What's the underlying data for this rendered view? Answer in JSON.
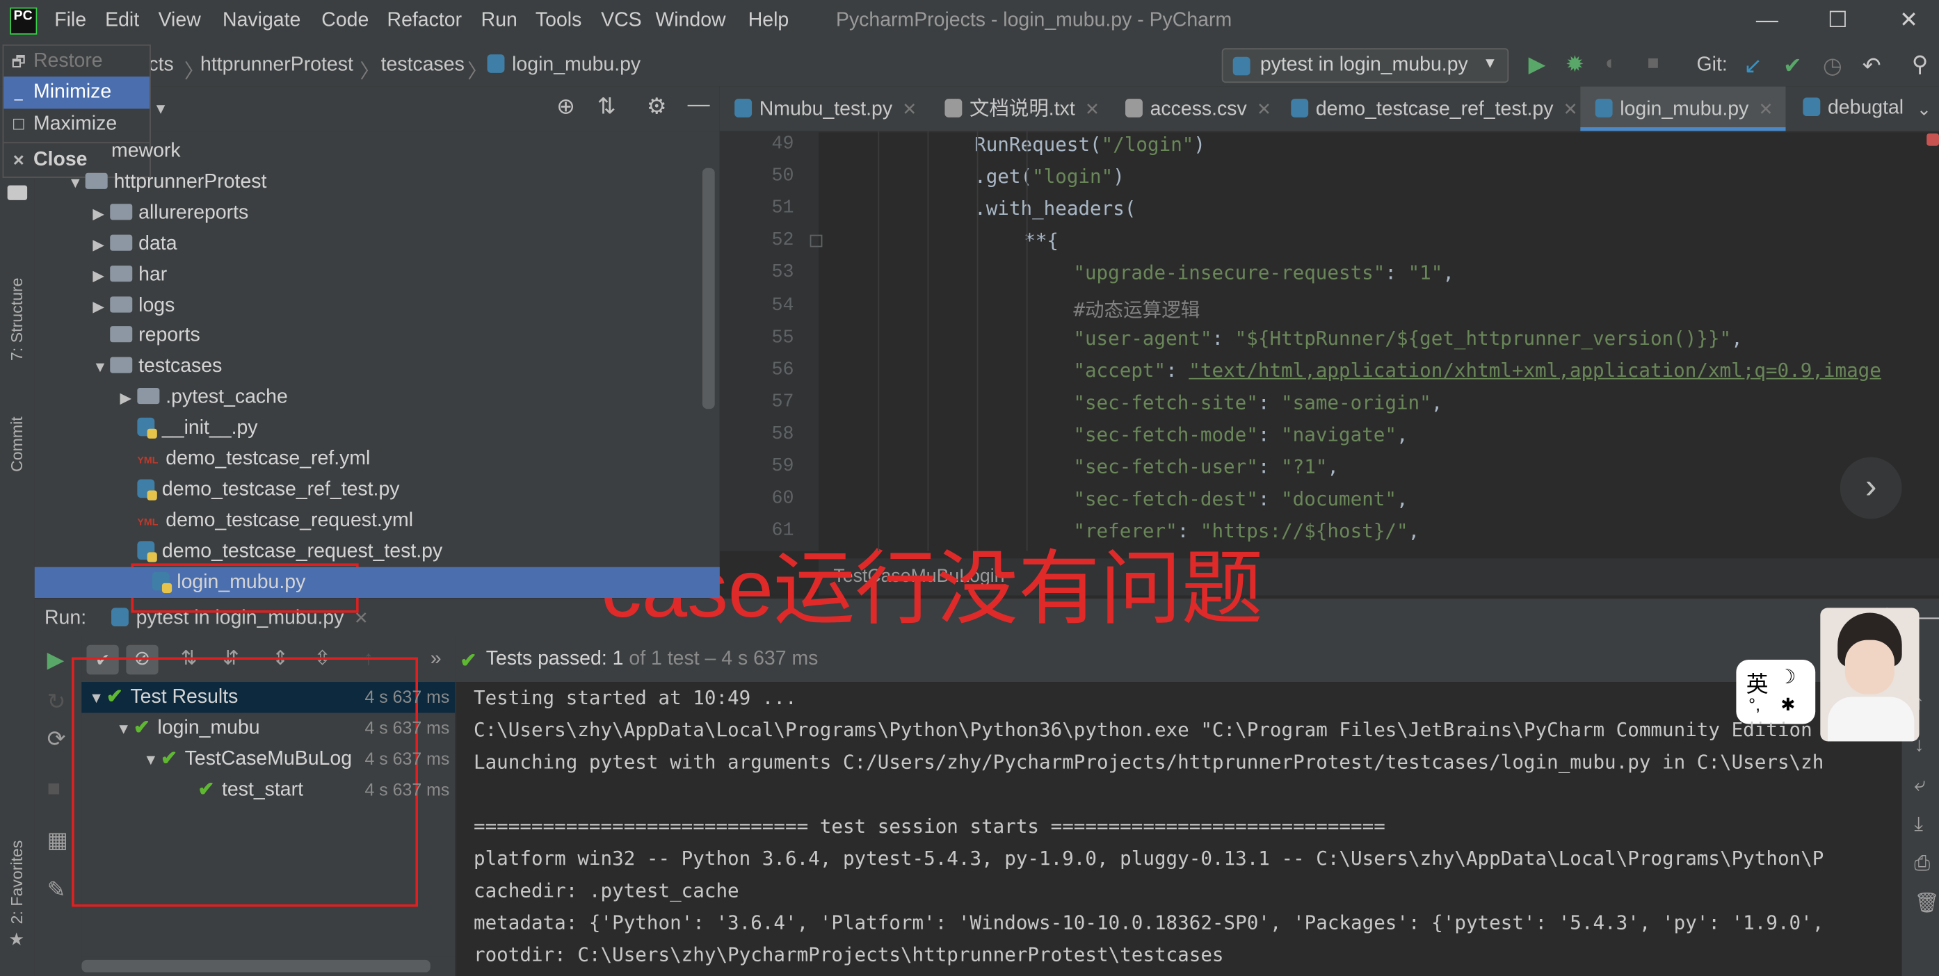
{
  "window": {
    "title": "PycharmProjects - login_mubu.py - PyCharm",
    "app_logo": "PC",
    "minimize_glyph": "—",
    "maximize_glyph": "☐",
    "close_glyph": "✕"
  },
  "menubar": {
    "items": [
      "File",
      "Edit",
      "View",
      "Navigate",
      "Code",
      "Refactor",
      "Run",
      "Tools",
      "VCS",
      "Window",
      "Help"
    ]
  },
  "system_menu": {
    "items": [
      {
        "key": "🗗",
        "label": "Restore",
        "enabled": false
      },
      {
        "key": "_",
        "label": "Minimize",
        "enabled": true,
        "selected": true
      },
      {
        "key": "☐",
        "label": "Maximize",
        "enabled": true
      },
      {
        "key": "✕",
        "label": "Close",
        "enabled": true,
        "bold": true
      }
    ]
  },
  "navbar": {
    "breadcrumbs": [
      "cts",
      "httprunnerProtest",
      "testcases",
      "login_mubu.py"
    ],
    "run_config": "pytest in login_mubu.py",
    "git_label": "Git:"
  },
  "left_stripe": {
    "structure": "7: Structure",
    "commit": "Commit",
    "favorites": "2: Favorites"
  },
  "project_tree": {
    "rows": [
      {
        "indent": 90,
        "label": "mework",
        "type": "text"
      },
      {
        "indent": 55,
        "label": "httprunnerProtest",
        "type": "folder",
        "expanded": true
      },
      {
        "indent": 75,
        "label": "allurereports",
        "type": "folder",
        "collapsed": true
      },
      {
        "indent": 75,
        "label": "data",
        "type": "folder",
        "collapsed": true
      },
      {
        "indent": 75,
        "label": "har",
        "type": "folder",
        "collapsed": true
      },
      {
        "indent": 75,
        "label": "logs",
        "type": "folder",
        "collapsed": true
      },
      {
        "indent": 75,
        "label": "reports",
        "type": "folder",
        "leaf": true
      },
      {
        "indent": 75,
        "label": "testcases",
        "type": "folder",
        "expanded": true
      },
      {
        "indent": 97,
        "label": ".pytest_cache",
        "type": "folder",
        "collapsed": true
      },
      {
        "indent": 97,
        "label": "__init__.py",
        "type": "py",
        "leaf": true
      },
      {
        "indent": 97,
        "label": "demo_testcase_ref.yml",
        "type": "yml",
        "leaf": true
      },
      {
        "indent": 97,
        "label": "demo_testcase_ref_test.py",
        "type": "py",
        "leaf": true
      },
      {
        "indent": 97,
        "label": "demo_testcase_request.yml",
        "type": "yml",
        "leaf": true
      },
      {
        "indent": 97,
        "label": "demo_testcase_request_test.py",
        "type": "py",
        "leaf": true
      },
      {
        "indent": 97,
        "label": "login_mubu.py",
        "type": "py",
        "leaf": true,
        "selected": true
      }
    ]
  },
  "editor_tabs": [
    {
      "label": "Nmubu_test.py",
      "active": false
    },
    {
      "label": "文档说明.txt",
      "active": false
    },
    {
      "label": "access.csv",
      "active": false
    },
    {
      "label": "demo_testcase_ref_test.py",
      "active": false
    },
    {
      "label": "login_mubu.py",
      "active": true
    },
    {
      "label": "debugtal",
      "active": false
    }
  ],
  "code": {
    "lines": [
      {
        "n": "49",
        "indent": 788,
        "parts": [
          [
            "RunRequest(",
            ""
          ],
          [
            "\"/login\"",
            "str"
          ],
          [
            ")",
            ""
          ]
        ]
      },
      {
        "n": "50",
        "indent": 788,
        "parts": [
          [
            ".get(",
            ""
          ],
          [
            "\"login\"",
            "str"
          ],
          [
            ")",
            ""
          ]
        ]
      },
      {
        "n": "51",
        "indent": 788,
        "parts": [
          [
            ".with_headers(",
            ""
          ]
        ]
      },
      {
        "n": "52",
        "indent": 828,
        "parts": [
          [
            "**{",
            ""
          ]
        ]
      },
      {
        "n": "53",
        "indent": 868,
        "parts": [
          [
            "\"upgrade-insecure-requests\"",
            "str"
          ],
          [
            ": ",
            ""
          ],
          [
            "\"1\"",
            "str"
          ],
          [
            ",",
            ""
          ]
        ]
      },
      {
        "n": "54",
        "indent": 868,
        "parts": [
          [
            "#动态运算逻辑",
            "cmt"
          ]
        ]
      },
      {
        "n": "55",
        "indent": 868,
        "parts": [
          [
            "\"user-agent\"",
            "str"
          ],
          [
            ": ",
            ""
          ],
          [
            "\"${HttpRunner/${get_httprunner_version()}}\"",
            "str"
          ],
          [
            ",",
            ""
          ]
        ]
      },
      {
        "n": "56",
        "indent": 868,
        "parts": [
          [
            "\"accept\"",
            "str"
          ],
          [
            ": ",
            ""
          ],
          [
            "\"text/html,application/xhtml+xml,application/xml;q=0.9,image",
            "str und"
          ]
        ]
      },
      {
        "n": "57",
        "indent": 868,
        "parts": [
          [
            "\"sec-fetch-site\"",
            "str"
          ],
          [
            ": ",
            ""
          ],
          [
            "\"same-origin\"",
            "str"
          ],
          [
            ",",
            ""
          ]
        ]
      },
      {
        "n": "58",
        "indent": 868,
        "parts": [
          [
            "\"sec-fetch-mode\"",
            "str"
          ],
          [
            ": ",
            ""
          ],
          [
            "\"navigate\"",
            "str"
          ],
          [
            ",",
            ""
          ]
        ]
      },
      {
        "n": "59",
        "indent": 868,
        "parts": [
          [
            "\"sec-fetch-user\"",
            "str"
          ],
          [
            ": ",
            ""
          ],
          [
            "\"?1\"",
            "str"
          ],
          [
            ",",
            ""
          ]
        ]
      },
      {
        "n": "60",
        "indent": 868,
        "parts": [
          [
            "\"sec-fetch-dest\"",
            "str"
          ],
          [
            ": ",
            ""
          ],
          [
            "\"document\"",
            "str"
          ],
          [
            ",",
            ""
          ]
        ]
      },
      {
        "n": "61",
        "indent": 868,
        "parts": [
          [
            "\"referer\"",
            "str"
          ],
          [
            ": ",
            ""
          ],
          [
            "\"https://${host}/\"",
            "str"
          ],
          [
            ",",
            ""
          ]
        ]
      }
    ],
    "structure_breadcrumb": "TestCaseMuBuLogin"
  },
  "run_panel": {
    "label": "Run:",
    "tab": "pytest in login_mubu.py",
    "status_prefix": "Tests passed:",
    "status_count": "1",
    "status_rest": "of 1 test – 4 s 637 ms"
  },
  "test_tree": [
    {
      "indent": 72,
      "label": "Test Results",
      "time": "4 s 637 ms"
    },
    {
      "indent": 94,
      "label": "login_mubu",
      "time": "4 s 637 ms"
    },
    {
      "indent": 116,
      "label": "TestCaseMuBuLog",
      "time": "4 s 637 ms"
    },
    {
      "indent": 160,
      "label": "test_start",
      "time": "4 s 637 ms"
    }
  ],
  "console": {
    "lines": [
      "Testing started at 10:49 ...",
      "C:\\Users\\zhy\\AppData\\Local\\Programs\\Python\\Python36\\python.exe \"C:\\Program Files\\JetBrains\\PyCharm Community Edition",
      "Launching pytest with arguments C:/Users/zhy/PycharmProjects/httprunnerProtest/testcases/login_mubu.py in C:\\Users\\zh",
      "",
      "============================= test session starts =============================",
      "platform win32 -- Python 3.6.4, pytest-5.4.3, py-1.9.0, pluggy-0.13.1 -- C:\\Users\\zhy\\AppData\\Local\\Programs\\Python\\P",
      "cachedir: .pytest_cache",
      "metadata: {'Python': '3.6.4', 'Platform': 'Windows-10-10.0.18362-SP0', 'Packages': {'pytest': '5.4.3', 'py': '1.9.0',",
      "rootdir: C:\\Users\\zhy\\PycharmProjects\\httprunnerProtest\\testcases"
    ]
  },
  "annotation": {
    "text": "case运行没有问题",
    "color": "#e02a2a"
  },
  "ime": {
    "lang": "英",
    "moon": "☽",
    "punct": "°,"
  },
  "colors": {
    "accent": "#4b6eaf",
    "pass_green": "#5fb832",
    "string_green": "#6a8759",
    "annotation_red": "#e02020"
  }
}
